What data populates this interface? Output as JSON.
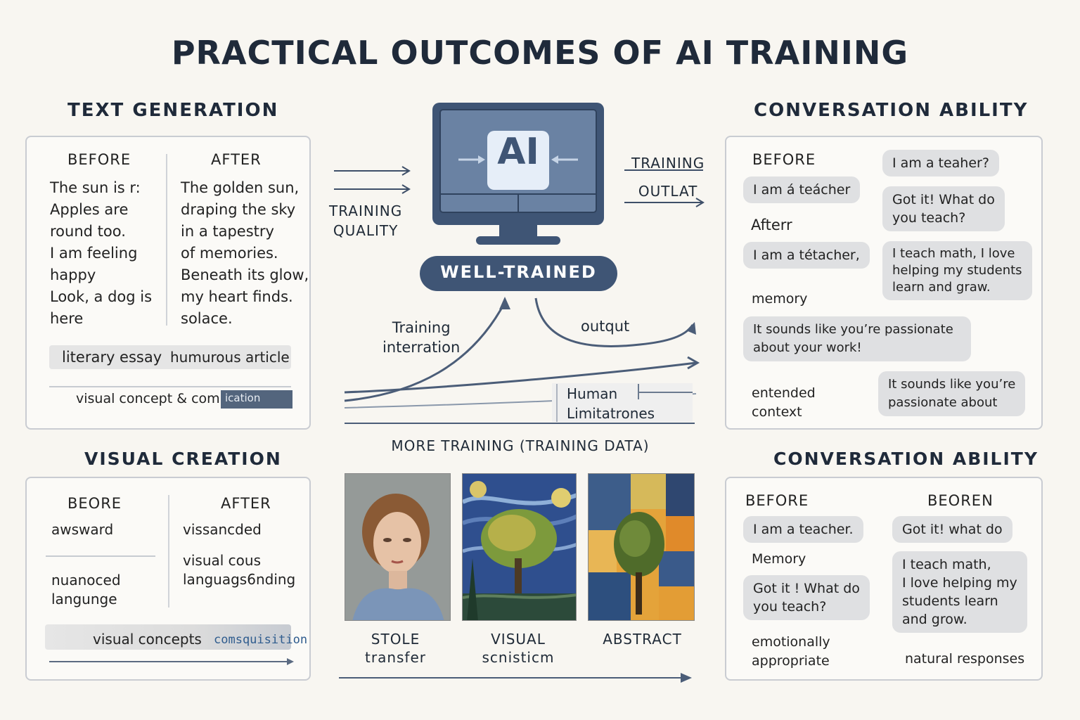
{
  "title": "PRACTICAL OUTCOMES OF AI TRAINING",
  "text_generation": {
    "title": "TEXT GENERATION",
    "before_label": "BEFORE",
    "after_label": "AFTER",
    "before_text": "The sun is r:\nApples are\nround too.\nI am feeling\nhappy\nLook, a dog is\nhere",
    "after_text": "The golden sun,\ndraping the sky\nin a tapestry\nof memories.\nBeneath its glow,\nmy heart finds.\nsolace.",
    "tag1": "literary essay",
    "tag2": "humurous article",
    "bar_text": "visual concept & compo",
    "bar_dark": "ication"
  },
  "center": {
    "ai_label": "AI",
    "well_trained": "WELL-TRAINED",
    "training_quality": "TRAINING\nQUALITY",
    "training_outlat": "TRAINING\nOUTLAT",
    "training_interration": "Training\ninterration",
    "output": "outqut",
    "human_limit": "Human\nLimitatrones",
    "more_training": "MORE TRAINING (TRAINING DATA)",
    "art_captions": [
      "STOLE\ntransfer",
      "VISUAL\nscnisticm",
      "ABSTRACT"
    ]
  },
  "conversation_top": {
    "title": "CONVERSATION ABILITY",
    "before_label": "BEFORE",
    "after_label": "Afterr",
    "memory_label": "memory",
    "extended_label": "entended\ncontext",
    "bubbles_left": [
      "I am á teácher",
      "I am a tétacher,"
    ],
    "bubbles_right": [
      "I am a teaher?",
      "Got it! What do\nyou teach?",
      "I teach math, I love\nhelping my students\nlearn and graw."
    ],
    "wide_bubble": "It sounds like you’re passionate\nabout your work!",
    "bottom_bubble": "It sounds like you’re\npassionate about"
  },
  "visual_creation": {
    "title": "VISUAL CREATION",
    "before_label": "BEORE",
    "after_label": "AFTER",
    "before_1": "awsward",
    "before_2": "nuanoced\nlangunge",
    "after_1": "vissancded",
    "after_2": "visual cous\nlanguags6nding",
    "bar_text": "visual concepts",
    "bar_blue": "comsquisition"
  },
  "conversation_bottom": {
    "title": "CONVERSATION ABILITY",
    "before_label": "BEFORE",
    "after_label": "BEOREN",
    "bubble_1": "I am a teacher.",
    "memory_label": "Memory",
    "bubble_2": "Got it ! What do\nyou teach?",
    "emotion_label": "emotionally\nappropriate",
    "bubble_3": "Got it! what do",
    "bubble_4": "I teach math,\nI love helping my\nstudents learn\nand grow.",
    "natural_label": "natural responses"
  }
}
